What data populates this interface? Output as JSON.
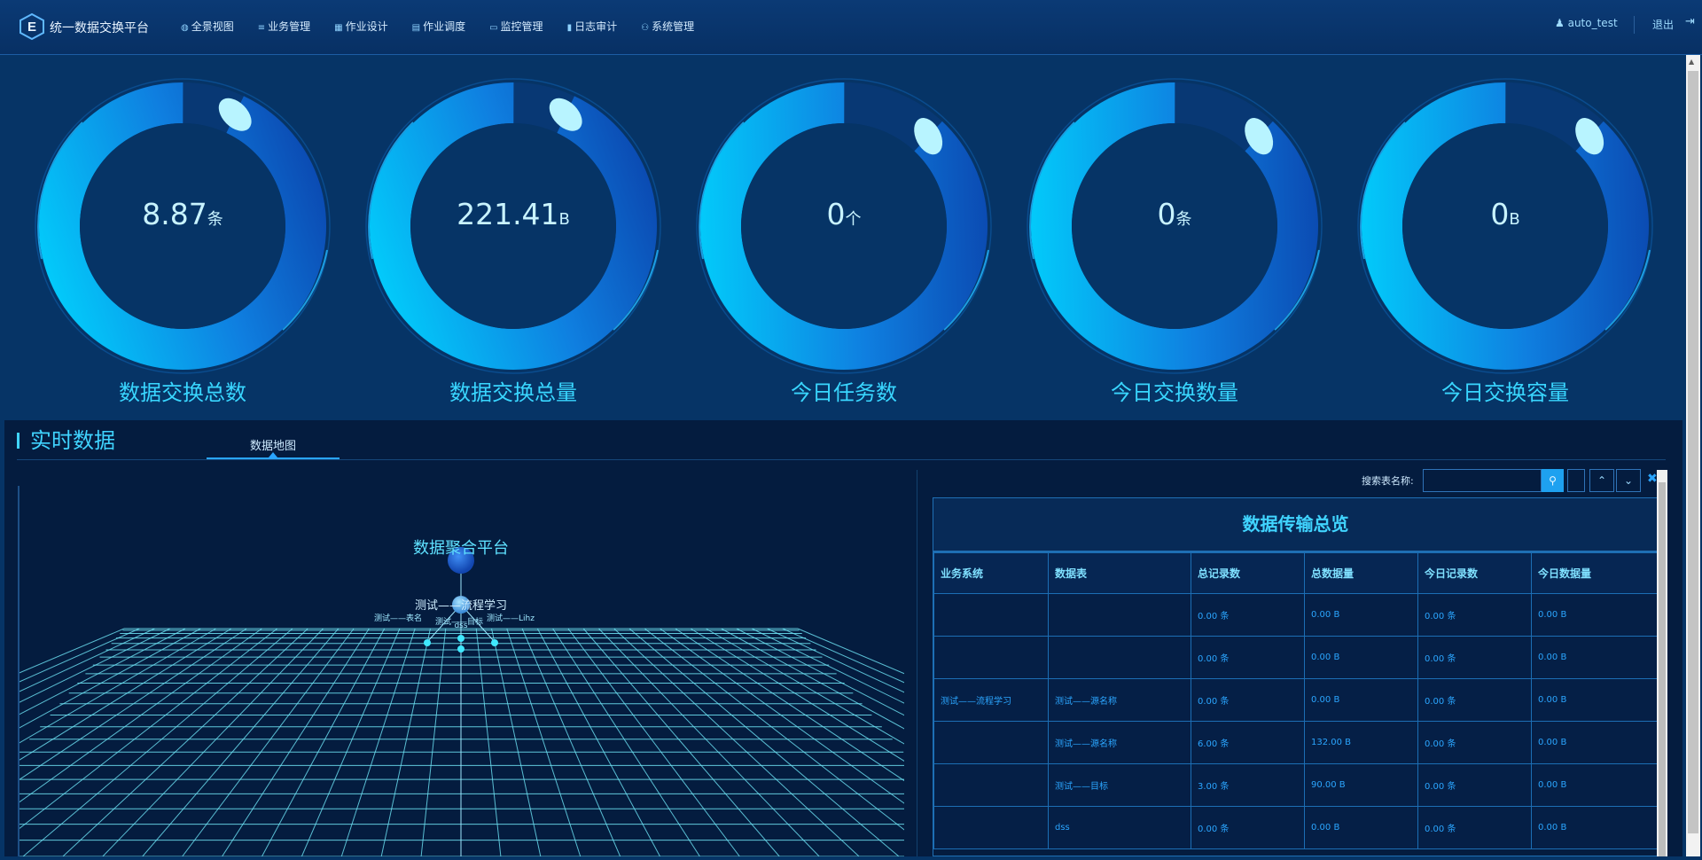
{
  "header": {
    "app_title": "统一数据交换平台",
    "nav": [
      {
        "label": "全景视图",
        "icon": "globe-icon",
        "glyph": "◍"
      },
      {
        "label": "业务管理",
        "icon": "database-icon",
        "glyph": "≡"
      },
      {
        "label": "作业设计",
        "icon": "grid-icon",
        "glyph": "▦"
      },
      {
        "label": "作业调度",
        "icon": "file-icon",
        "glyph": "▤"
      },
      {
        "label": "监控管理",
        "icon": "monitor-icon",
        "glyph": "▭"
      },
      {
        "label": "日志审计",
        "icon": "bar-chart-icon",
        "glyph": "▮"
      },
      {
        "label": "系统管理",
        "icon": "sitemap-icon",
        "glyph": "⚇"
      }
    ],
    "user": "auto_test",
    "logout": "退出"
  },
  "gauges": [
    {
      "value": "8.87",
      "unit": "条",
      "label": "数据交换总数",
      "fill": 0.93
    },
    {
      "value": "221.41",
      "unit": "B",
      "label": "数据交换总量",
      "fill": 0.93
    },
    {
      "value": "0",
      "unit": "个",
      "label": "今日任务数",
      "fill": 0.88
    },
    {
      "value": "0",
      "unit": "条",
      "label": "今日交换数量",
      "fill": 0.88
    },
    {
      "value": "0",
      "unit": "B",
      "label": "今日交换容量",
      "fill": 0.88
    }
  ],
  "realtime": {
    "title": "实时数据",
    "tab": "数据地图",
    "map": {
      "title": "数据聚合平台",
      "subtitle": "测试——流程学习",
      "leaf_labels": [
        "测试——表名",
        "测试——目标",
        "dss",
        "测试——Lihz"
      ]
    },
    "search": {
      "label": "搜索表名称:",
      "placeholder": ""
    },
    "table": {
      "title": "数据传输总览",
      "headers": [
        "业务系统",
        "数据表",
        "总记录数",
        "总数据量",
        "今日记录数",
        "今日数据量"
      ],
      "rows": [
        [
          "",
          "",
          "0.00 条",
          "0.00 B",
          "0.00 条",
          "0.00 B"
        ],
        [
          "",
          "",
          "0.00 条",
          "0.00 B",
          "0.00 条",
          "0.00 B"
        ],
        [
          "测试——流程学习",
          "测试——源名称",
          "0.00 条",
          "0.00 B",
          "0.00 条",
          "0.00 B"
        ],
        [
          "",
          "测试——源名称",
          "6.00 条",
          "132.00 B",
          "0.00 条",
          "0.00 B"
        ],
        [
          "",
          "测试——目标",
          "3.00 条",
          "90.00 B",
          "0.00 条",
          "0.00 B"
        ],
        [
          "",
          "dss",
          "0.00 条",
          "0.00 B",
          "0.00 条",
          "0.00 B"
        ]
      ]
    }
  },
  "colors": {
    "accent": "#40d4ff",
    "background": "#063466",
    "panel": "#041c3f",
    "ring_start": "#00d8ff",
    "ring_end": "#0a3fa8"
  }
}
